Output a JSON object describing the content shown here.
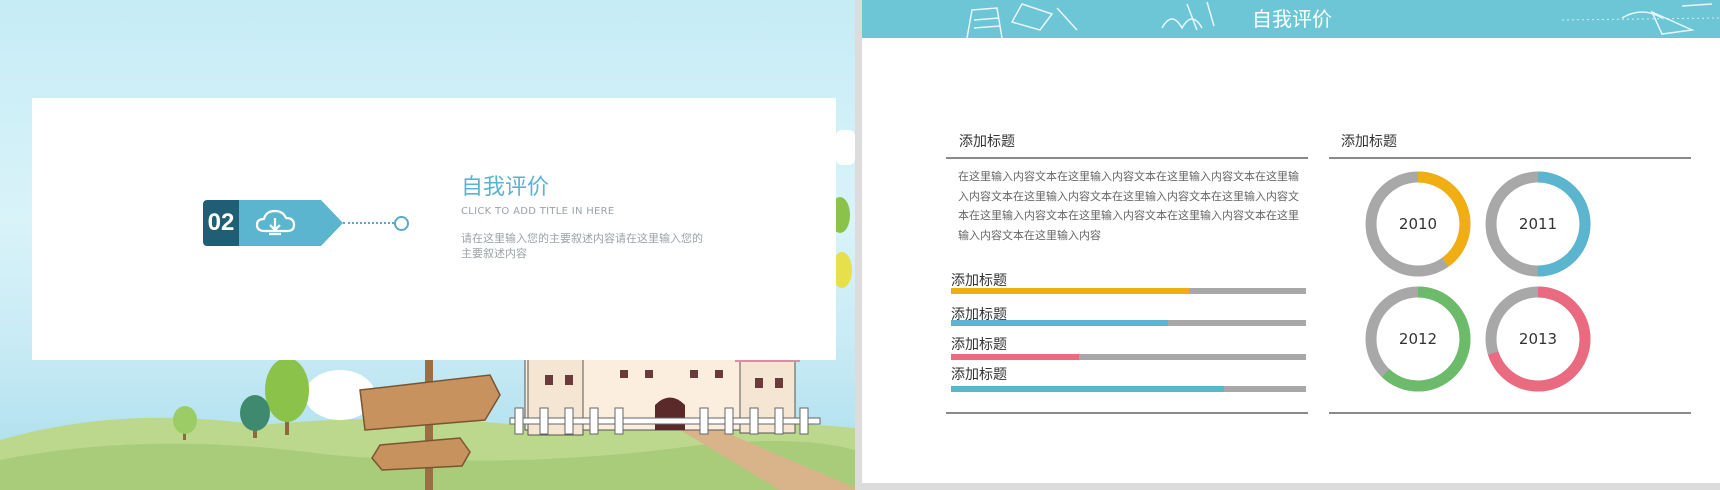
{
  "left_slide": {
    "number": "02",
    "title": "自我评价",
    "subtitle": "CLICK TO ADD TITLE IN HERE",
    "description": "请在这里输入您的主要叙述内容请在这里输入您的主要叙述内容",
    "icon": "cloud-download-icon",
    "colors": {
      "badge_dark": "#1f5e74",
      "badge_light": "#5bb5cf",
      "title": "#5bb5cf"
    }
  },
  "right_slide": {
    "title": "自我评价",
    "left_section": {
      "heading": "添加标题",
      "body": "在这里输入内容文本在这里输入内容文本在这里输入内容文本在这里输入内容文本在这里输入内容文本在这里输入内容文本在这里输入内容文本在这里输入内容文本在这里输入内容文本在这里输入内容文本在这里输入内容文本在这里输入内容",
      "bars": [
        {
          "label": "添加标题",
          "value": 0.67,
          "color": "#f0ae13"
        },
        {
          "label": "添加标题",
          "value": 0.61,
          "color": "#5bb5cf"
        },
        {
          "label": "添加标题",
          "value": 0.36,
          "color": "#ea6a80"
        },
        {
          "label": "添加标题",
          "value": 0.77,
          "color": "#5bb5cf"
        }
      ]
    },
    "right_section": {
      "heading": "添加标题",
      "donuts": [
        {
          "label": "2010",
          "value": 0.4,
          "color": "#f0ae13"
        },
        {
          "label": "2011",
          "value": 0.5,
          "color": "#5bb5cf"
        },
        {
          "label": "2012",
          "value": 0.62,
          "color": "#6cbb6b"
        },
        {
          "label": "2013",
          "value": 0.7,
          "color": "#ea6a80"
        }
      ],
      "track_color": "#a8a8a8"
    }
  }
}
